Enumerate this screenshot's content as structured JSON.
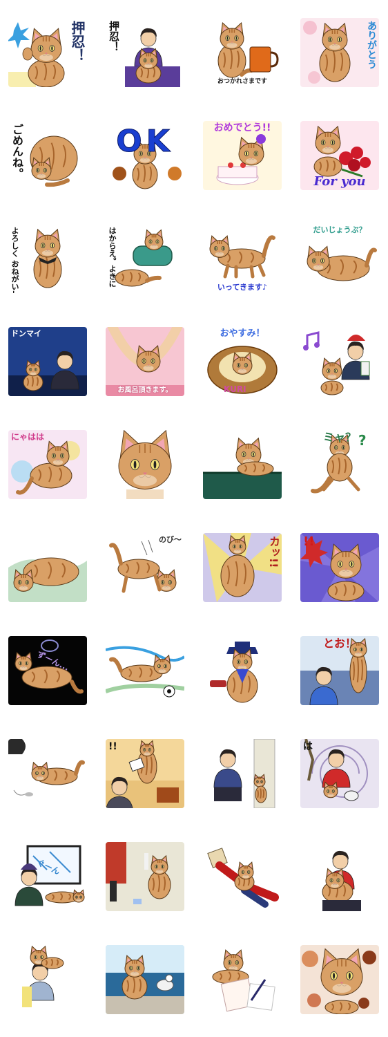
{
  "stickers": [
    {
      "id": "s1",
      "caption": "押忍！",
      "scene": "cat-wave",
      "bg": "#ffffff",
      "accent": "#3aa0e0",
      "capColor": "#223366",
      "capStyle": "vert-right",
      "capSize": 20
    },
    {
      "id": "s2",
      "caption": "押忍！",
      "scene": "man-cat",
      "bg": "#ffffff",
      "accent": "#5a3d9a",
      "capColor": "#111111",
      "capStyle": "vert-left",
      "capSize": 15
    },
    {
      "id": "s3",
      "caption": "おつかれさまです",
      "scene": "cat-mug",
      "bg": "#ffffff",
      "accent": "#e06a1a",
      "capColor": "#222222",
      "capStyle": "bottom",
      "capSize": 9
    },
    {
      "id": "s4",
      "caption": "ありがとう",
      "scene": "cat-sit",
      "bg": "#fbe9ef",
      "accent": "#f4b7c8",
      "capColor": "#2a8ad4",
      "capStyle": "vert-right",
      "capSize": 14
    },
    {
      "id": "s5",
      "caption": "ごめんね。",
      "scene": "cat-curl",
      "bg": "#ffffff",
      "accent": "#d89a5a",
      "capColor": "#111111",
      "capStyle": "vert-left",
      "capSize": 16
    },
    {
      "id": "s6",
      "caption": "OK",
      "scene": "cat-ok",
      "bg": "#ffffff",
      "accent": "#1a3fd0",
      "capColor": "#1a3fd0",
      "capStyle": "big",
      "capSize": 44
    },
    {
      "id": "s7",
      "caption": "おめでとう!!",
      "scene": "cat-cake",
      "bg": "#fff7e0",
      "accent": "#e05aa0",
      "capColor": "#b03adc",
      "capStyle": "top",
      "capSize": 14
    },
    {
      "id": "s8",
      "caption": "For you",
      "scene": "cat-rose",
      "bg": "#fde6ee",
      "accent": "#d01a2a",
      "capColor": "#4a2ad0",
      "capStyle": "bottom-script",
      "capSize": 18
    },
    {
      "id": "s9",
      "caption": "よろしく おねがいします",
      "scene": "cat-bow",
      "bg": "#ffffff",
      "accent": "#d89a5a",
      "capColor": "#111111",
      "capStyle": "vert-pair",
      "capSize": 11
    },
    {
      "id": "s10",
      "caption": "はからえ。よきに",
      "scene": "cat-lounge",
      "bg": "#ffffff",
      "accent": "#3a9a8a",
      "capColor": "#111111",
      "capStyle": "vert-pair",
      "capSize": 11
    },
    {
      "id": "s11",
      "caption": "いってきます♪",
      "scene": "cat-walk",
      "bg": "#ffffff",
      "accent": "#2a5ad0",
      "capColor": "#2a3ad0",
      "capStyle": "bottom",
      "capSize": 11
    },
    {
      "id": "s12",
      "caption": "だいじょうぶ？",
      "scene": "cat-lie",
      "bg": "#ffffff",
      "accent": "#3a9a8a",
      "capColor": "#2a9a8a",
      "capStyle": "top",
      "capSize": 11
    },
    {
      "id": "s13",
      "caption": "ドンマイ",
      "scene": "night-sit",
      "bg": "#1f3f8a",
      "accent": "#4a7ad0",
      "capColor": "#ffffff",
      "capStyle": "top-left",
      "capSize": 11
    },
    {
      "id": "s14",
      "caption": "お風呂頂きます。",
      "scene": "bath",
      "bg": "#f7c6d2",
      "accent": "#e98aa4",
      "capColor": "#ffffff",
      "capStyle": "bottom-banner",
      "capSize": 10
    },
    {
      "id": "s15",
      "caption": "おやすみ！",
      "scene": "bed",
      "bg": "#ffffff",
      "accent": "#b07a3a",
      "capColor": "#3a6ae0",
      "capStyle": "top",
      "capSize": 13
    },
    {
      "id": "s16",
      "caption": "",
      "scene": "music",
      "bg": "#ffffff",
      "accent": "#d02a2a",
      "capColor": "#8a4ad0",
      "capStyle": "none",
      "capSize": 12
    },
    {
      "id": "s17",
      "caption": "にゃはは",
      "scene": "laugh",
      "bg": "#f7e6f3",
      "accent": "#e05aa0",
      "capColor": "#d03a8a",
      "capStyle": "top-left",
      "capSize": 12
    },
    {
      "id": "s18",
      "caption": "",
      "scene": "face-close",
      "bg": "#ffffff",
      "accent": "#d89a5a",
      "capColor": "#111111",
      "capStyle": "none",
      "capSize": 12
    },
    {
      "id": "s19",
      "caption": "",
      "scene": "chair",
      "bg": "#ffffff",
      "accent": "#1f5a4a",
      "capColor": "#111111",
      "capStyle": "none",
      "capSize": 12
    },
    {
      "id": "s20",
      "caption": "ミャ？",
      "scene": "cat-jump",
      "bg": "#ffffff",
      "accent": "#2a8a4a",
      "capColor": "#2a7a4a",
      "capStyle": "top",
      "capSize": 16
    },
    {
      "id": "s21",
      "caption": "",
      "scene": "grass",
      "bg": "#ffffff",
      "accent": "#9acaa0",
      "capColor": "#111111",
      "capStyle": "none",
      "capSize": 12
    },
    {
      "id": "s22",
      "caption": "のび〜",
      "scene": "stretch",
      "bg": "#ffffff",
      "accent": "#d89a5a",
      "capColor": "#333333",
      "capStyle": "top-right",
      "capSize": 11
    },
    {
      "id": "s23",
      "caption": "カッ!!",
      "scene": "flash",
      "bg": "#cfc9ea",
      "accent": "#f4e27a",
      "capColor": "#b02020",
      "capStyle": "vert-right",
      "capSize": 16
    },
    {
      "id": "s24",
      "caption": "!!",
      "scene": "shock",
      "bg": "#6a5ad0",
      "accent": "#d02a2a",
      "capColor": "#d01a1a",
      "capStyle": "top-left",
      "capSize": 18
    },
    {
      "id": "s25",
      "caption": "ずーん...",
      "scene": "dark",
      "bg": "#050505",
      "accent": "#6a5ad0",
      "capColor": "#b090e0",
      "capStyle": "diagonal",
      "capSize": 12
    },
    {
      "id": "s26",
      "caption": "",
      "scene": "soccer",
      "bg": "#ffffff",
      "accent": "#3aa0e0",
      "capColor": "#111111",
      "capStyle": "none",
      "capSize": 12
    },
    {
      "id": "s27",
      "caption": "",
      "scene": "station",
      "bg": "#ffffff",
      "accent": "#1f2f7a",
      "capColor": "#111111",
      "capStyle": "none",
      "capSize": 12
    },
    {
      "id": "s28",
      "caption": "とお！",
      "scene": "pounce",
      "bg": "#dbe7f3",
      "accent": "#3a6ad0",
      "capColor": "#c01a1a",
      "capStyle": "top",
      "capSize": 16
    },
    {
      "id": "s29",
      "caption": "",
      "scene": "toy",
      "bg": "#ffffff",
      "accent": "#8a8a8a",
      "capColor": "#111111",
      "capStyle": "none",
      "capSize": 12
    },
    {
      "id": "s30",
      "caption": "!!",
      "scene": "chaos",
      "bg": "#f4d79a",
      "accent": "#a04a1a",
      "capColor": "#111111",
      "capStyle": "top-left",
      "capSize": 14
    },
    {
      "id": "s31",
      "caption": "",
      "scene": "door",
      "bg": "#ffffff",
      "accent": "#3a4a8a",
      "capColor": "#111111",
      "capStyle": "none",
      "capSize": 12
    },
    {
      "id": "s32",
      "caption": "は",
      "scene": "spiral",
      "bg": "#e9e4f1",
      "accent": "#d02a2a",
      "capColor": "#111111",
      "capStyle": "top-left",
      "capSize": 14
    },
    {
      "id": "s33",
      "caption": "ぐーん",
      "scene": "computer",
      "bg": "#ffffff",
      "accent": "#3a8ad0",
      "capColor": "#3a8ad0",
      "capStyle": "diagonal",
      "capSize": 12
    },
    {
      "id": "s34",
      "caption": "",
      "scene": "mess",
      "bg": "#e9e6d6",
      "accent": "#c03a2a",
      "capColor": "#111111",
      "capStyle": "none",
      "capSize": 12
    },
    {
      "id": "s35",
      "caption": "",
      "scene": "box-head",
      "bg": "#ffffff",
      "accent": "#c01a1a",
      "capColor": "#111111",
      "capStyle": "none",
      "capSize": 12
    },
    {
      "id": "s36",
      "caption": "",
      "scene": "hug",
      "bg": "#ffffff",
      "accent": "#d02a2a",
      "capColor": "#111111",
      "capStyle": "none",
      "capSize": 12
    },
    {
      "id": "s37",
      "caption": "",
      "scene": "shoulder",
      "bg": "#ffffff",
      "accent": "#4a6aa0",
      "capColor": "#111111",
      "capStyle": "none",
      "capSize": 12
    },
    {
      "id": "s38",
      "caption": "",
      "scene": "sea",
      "bg": "#bfe0f3",
      "accent": "#2a6a9a",
      "capColor": "#111111",
      "capStyle": "none",
      "capSize": 12
    },
    {
      "id": "s39",
      "caption": "",
      "scene": "letter",
      "bg": "#ffffff",
      "accent": "#d06a3a",
      "capColor": "#111111",
      "capStyle": "none",
      "capSize": 12
    },
    {
      "id": "s40",
      "caption": "",
      "scene": "autumn",
      "bg": "#f4e3d6",
      "accent": "#d06a2a",
      "capColor": "#111111",
      "capStyle": "none",
      "capSize": 12
    }
  ]
}
